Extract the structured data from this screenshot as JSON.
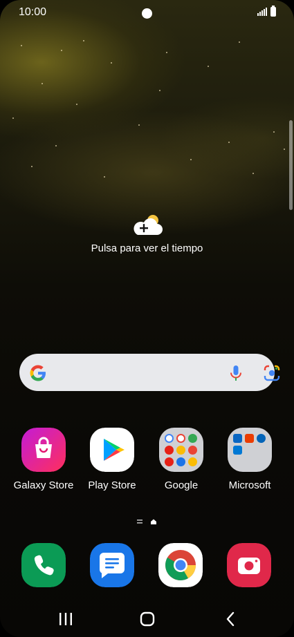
{
  "status_bar": {
    "time": "10:00"
  },
  "weather_widget": {
    "label": "Pulsa para ver el tiempo",
    "icon": "cloud-sun-add-icon"
  },
  "search_bar": {
    "logo": "google-g-icon",
    "mic": "mic-icon",
    "lens": "google-lens-icon"
  },
  "apps": [
    {
      "label": "Galaxy Store",
      "icon": "galaxy-store-icon",
      "color": "#e2156f"
    },
    {
      "label": "Play Store",
      "icon": "play-store-icon",
      "color": "#ffffff"
    },
    {
      "label": "Google",
      "icon": "folder-icon",
      "color": "#cfd0d4"
    },
    {
      "label": "Microsoft",
      "icon": "folder-icon",
      "color": "#cfd0d4"
    }
  ],
  "dock": [
    {
      "name": "phone",
      "icon": "phone-icon",
      "color": "#0b9b55"
    },
    {
      "name": "messages",
      "icon": "messages-icon",
      "color": "#1976e8"
    },
    {
      "name": "chrome",
      "icon": "chrome-icon",
      "color": "#ffffff"
    },
    {
      "name": "camera",
      "icon": "camera-icon",
      "color": "#e0284a"
    }
  ],
  "nav_bar": {
    "recents": "recents-icon",
    "home": "home-icon",
    "back": "back-icon"
  }
}
